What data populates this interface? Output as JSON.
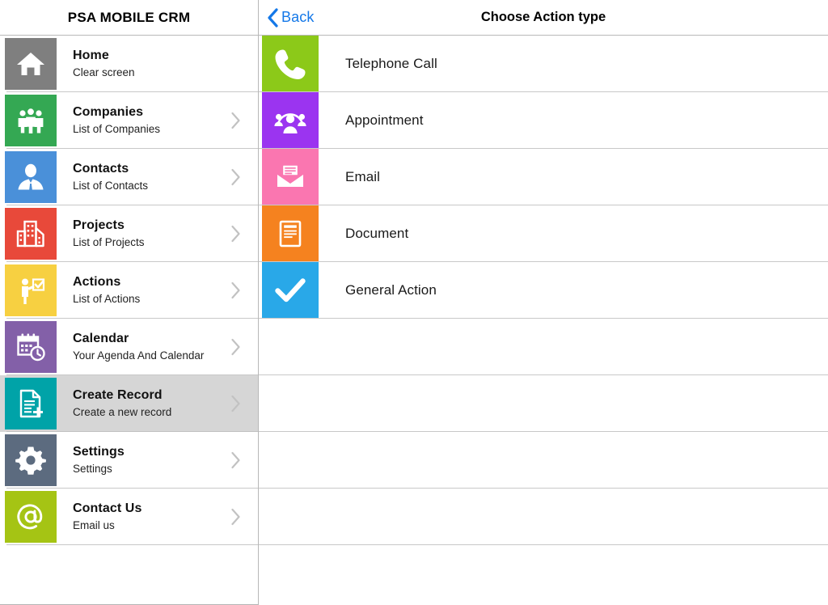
{
  "sidebar": {
    "title": "PSA MOBILE CRM",
    "items": [
      {
        "label": "Home",
        "sub": "Clear screen",
        "icon": "home-icon",
        "color": "#7f7f7f",
        "chevron": false,
        "selected": false
      },
      {
        "label": "Companies",
        "sub": "List of Companies",
        "icon": "people-group-icon",
        "color": "#34a853",
        "chevron": true,
        "selected": false
      },
      {
        "label": "Contacts",
        "sub": "List of Contacts",
        "icon": "person-icon",
        "color": "#4a90d9",
        "chevron": true,
        "selected": false
      },
      {
        "label": "Projects",
        "sub": "List of Projects",
        "icon": "buildings-icon",
        "color": "#e8493a",
        "chevron": true,
        "selected": false
      },
      {
        "label": "Actions",
        "sub": "List of Actions",
        "icon": "person-checklist-icon",
        "color": "#f7d041",
        "chevron": true,
        "selected": false
      },
      {
        "label": "Calendar",
        "sub": "Your Agenda And Calendar",
        "icon": "calendar-clock-icon",
        "color": "#8360a8",
        "chevron": true,
        "selected": false
      },
      {
        "label": "Create Record",
        "sub": "Create a new record",
        "icon": "document-plus-icon",
        "color": "#00a3a8",
        "chevron": true,
        "selected": true
      },
      {
        "label": "Settings",
        "sub": "Settings",
        "icon": "gear-icon",
        "color": "#5c6b7f",
        "chevron": true,
        "selected": false
      },
      {
        "label": "Contact Us",
        "sub": "Email us",
        "icon": "at-sign-icon",
        "color": "#a5c414",
        "chevron": true,
        "selected": false
      }
    ]
  },
  "detail": {
    "back_label": "Back",
    "title": "Choose Action type",
    "accent_color": "#1478e8",
    "actions": [
      {
        "label": "Telephone Call",
        "icon": "phone-icon",
        "color": "#8cc919"
      },
      {
        "label": "Appointment",
        "icon": "meeting-icon",
        "color": "#9b34f0"
      },
      {
        "label": "Email",
        "icon": "envelope-icon",
        "color": "#fa76b0"
      },
      {
        "label": "Document",
        "icon": "document-icon",
        "color": "#f5821f"
      },
      {
        "label": "General Action",
        "icon": "checkmark-icon",
        "color": "#29a8e8"
      }
    ],
    "empty_rows": 4
  }
}
